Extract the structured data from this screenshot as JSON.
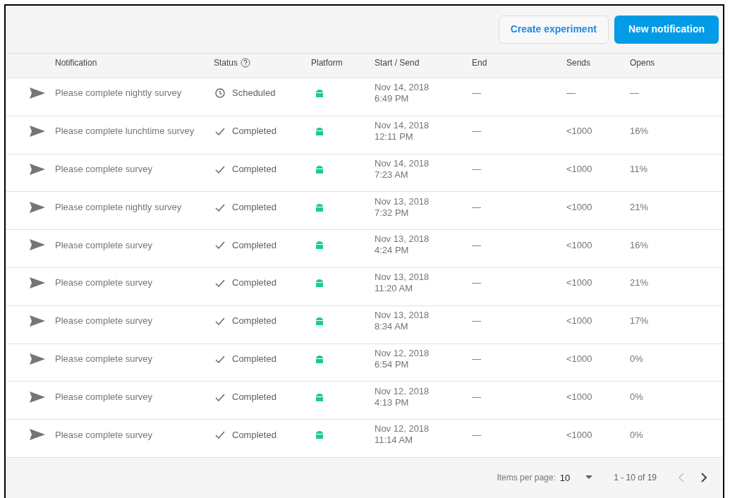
{
  "toolbar": {
    "buttons": [
      {
        "label": "Create experiment",
        "kind": "outlined"
      },
      {
        "label": "New notification",
        "kind": "filled"
      }
    ]
  },
  "table": {
    "columns": [
      {
        "label": "Notification"
      },
      {
        "label": "Status",
        "help": true
      },
      {
        "label": "Platform"
      },
      {
        "label": "Start / Send"
      },
      {
        "label": "End"
      },
      {
        "label": "Sends"
      },
      {
        "label": "Opens"
      }
    ],
    "rows": [
      {
        "notification": "Please complete nightly survey",
        "status": {
          "kind": "scheduled",
          "label": "Scheduled"
        },
        "date": "Nov 14, 2018",
        "time": "6:49 PM",
        "end": "—",
        "sends": "—",
        "opens": "—"
      },
      {
        "notification": "Please complete lunchtime survey",
        "status": {
          "kind": "completed",
          "label": "Completed"
        },
        "date": "Nov 14, 2018",
        "time": "12:11 PM",
        "end": "—",
        "sends": "<1000",
        "opens": "16%"
      },
      {
        "notification": "Please complete survey",
        "status": {
          "kind": "completed",
          "label": "Completed"
        },
        "date": "Nov 14, 2018",
        "time": "7:23 AM",
        "end": "—",
        "sends": "<1000",
        "opens": "11%"
      },
      {
        "notification": "Please complete nightly survey",
        "status": {
          "kind": "completed",
          "label": "Completed"
        },
        "date": "Nov 13, 2018",
        "time": "7:32 PM",
        "end": "—",
        "sends": "<1000",
        "opens": "21%"
      },
      {
        "notification": "Please complete survey",
        "status": {
          "kind": "completed",
          "label": "Completed"
        },
        "date": "Nov 13, 2018",
        "time": "4:24 PM",
        "end": "—",
        "sends": "<1000",
        "opens": "16%"
      },
      {
        "notification": "Please complete survey",
        "status": {
          "kind": "completed",
          "label": "Completed"
        },
        "date": "Nov 13, 2018",
        "time": "11:20 AM",
        "end": "—",
        "sends": "<1000",
        "opens": "21%"
      },
      {
        "notification": "Please complete survey",
        "status": {
          "kind": "completed",
          "label": "Completed"
        },
        "date": "Nov 13, 2018",
        "time": "8:34 AM",
        "end": "—",
        "sends": "<1000",
        "opens": "17%"
      },
      {
        "notification": "Please complete survey",
        "status": {
          "kind": "completed",
          "label": "Completed"
        },
        "date": "Nov 12, 2018",
        "time": "6:54 PM",
        "end": "—",
        "sends": "<1000",
        "opens": "0%"
      },
      {
        "notification": "Please complete survey",
        "status": {
          "kind": "completed",
          "label": "Completed"
        },
        "date": "Nov 12, 2018",
        "time": "4:13 PM",
        "end": "—",
        "sends": "<1000",
        "opens": "0%"
      },
      {
        "notification": "Please complete survey",
        "status": {
          "kind": "completed",
          "label": "Completed"
        },
        "date": "Nov 12, 2018",
        "time": "11:14 AM",
        "end": "—",
        "sends": "<1000",
        "opens": "0%"
      }
    ]
  },
  "pagination": {
    "label": "Items per page:",
    "per_page": "10",
    "range": "1 - 10 of 19",
    "previous_disabled": true,
    "next_disabled": false
  }
}
